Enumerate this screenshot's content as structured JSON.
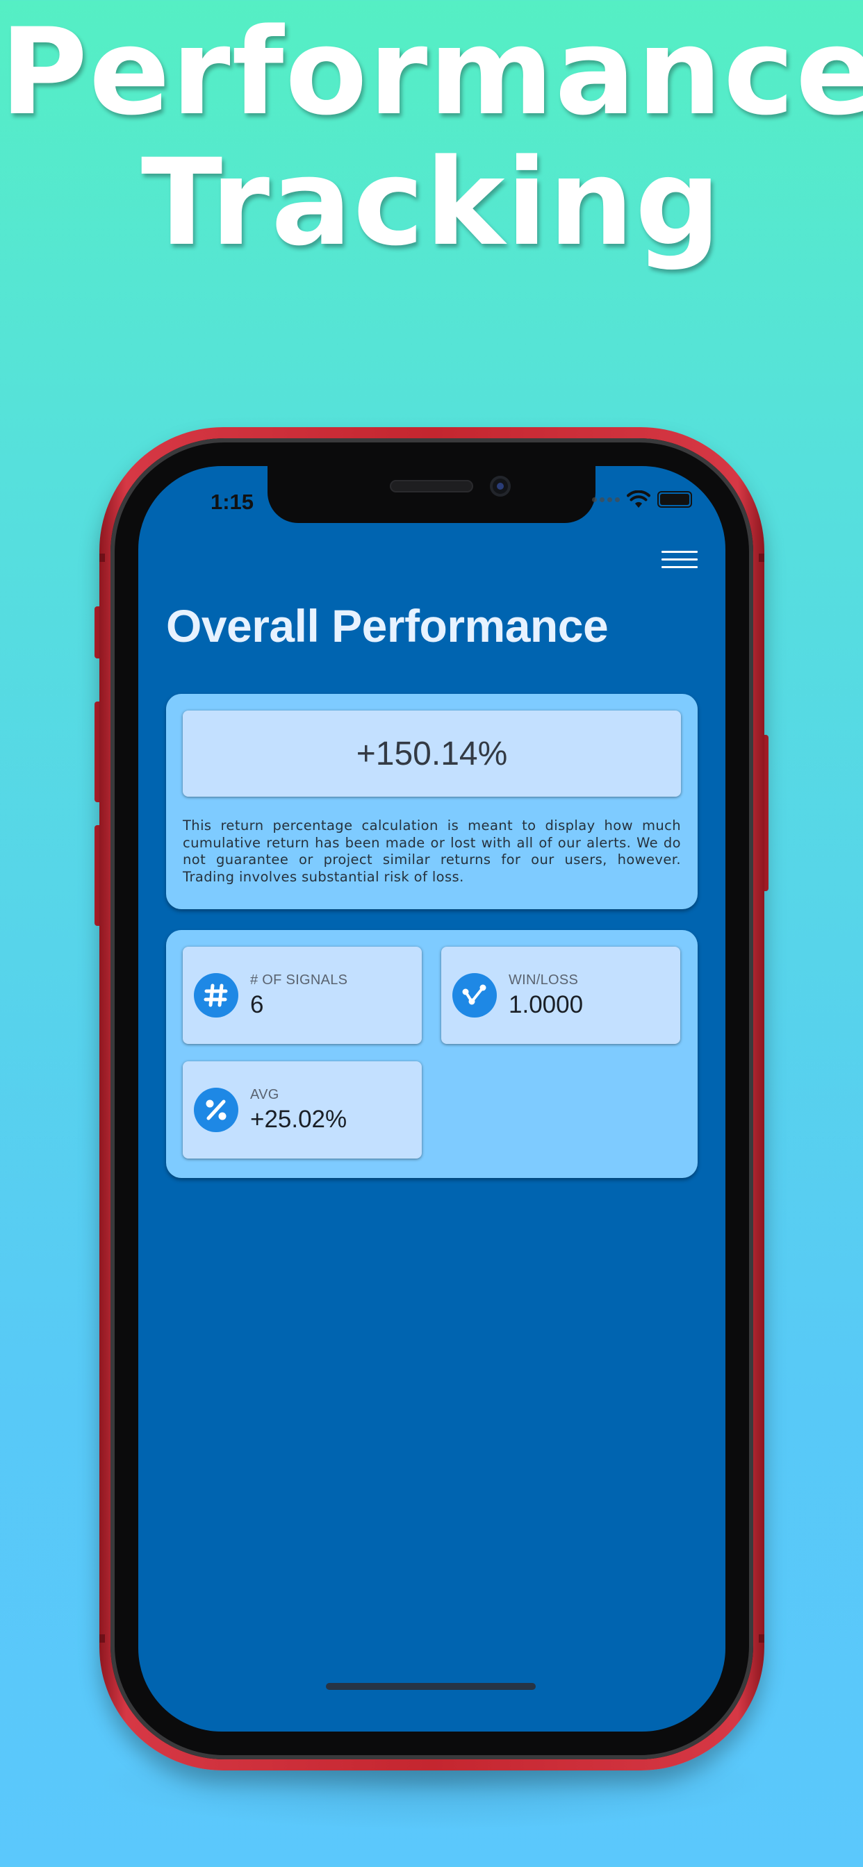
{
  "headline": {
    "line1": "Performance",
    "line2": "Tracking"
  },
  "status_bar": {
    "time": "1:15",
    "icons": [
      "signal-icon",
      "wifi-icon",
      "battery-icon"
    ]
  },
  "menu": {
    "icon": "hamburger-menu-icon"
  },
  "page": {
    "title": "Overall Performance"
  },
  "overall_return": {
    "value": "+150.14%",
    "disclaimer": "This return percentage calculation is meant to display how much cumulative return has been made or lost with all of our alerts. We do not guarantee or project similar returns for our users, however. Trading involves substantial risk of loss."
  },
  "stats": {
    "signals": {
      "label": "# OF SIGNALS",
      "value": "6",
      "icon": "hash-icon"
    },
    "win_loss": {
      "label": "WIN/LOSS",
      "value": "1.0000",
      "icon": "chart-line-icon"
    },
    "avg": {
      "label": "AVG",
      "value": "+25.02%",
      "icon": "percent-icon"
    }
  },
  "colors": {
    "background_top": "#55efc4",
    "background_bottom": "#5bc8fc",
    "phone_frame": "#c4262f",
    "screen_background": "#0064b0",
    "card_background": "#7ecbff",
    "tile_background": "#c3e0ff",
    "icon_circle": "#1e88e5",
    "title_text": "#e7f2ff"
  }
}
